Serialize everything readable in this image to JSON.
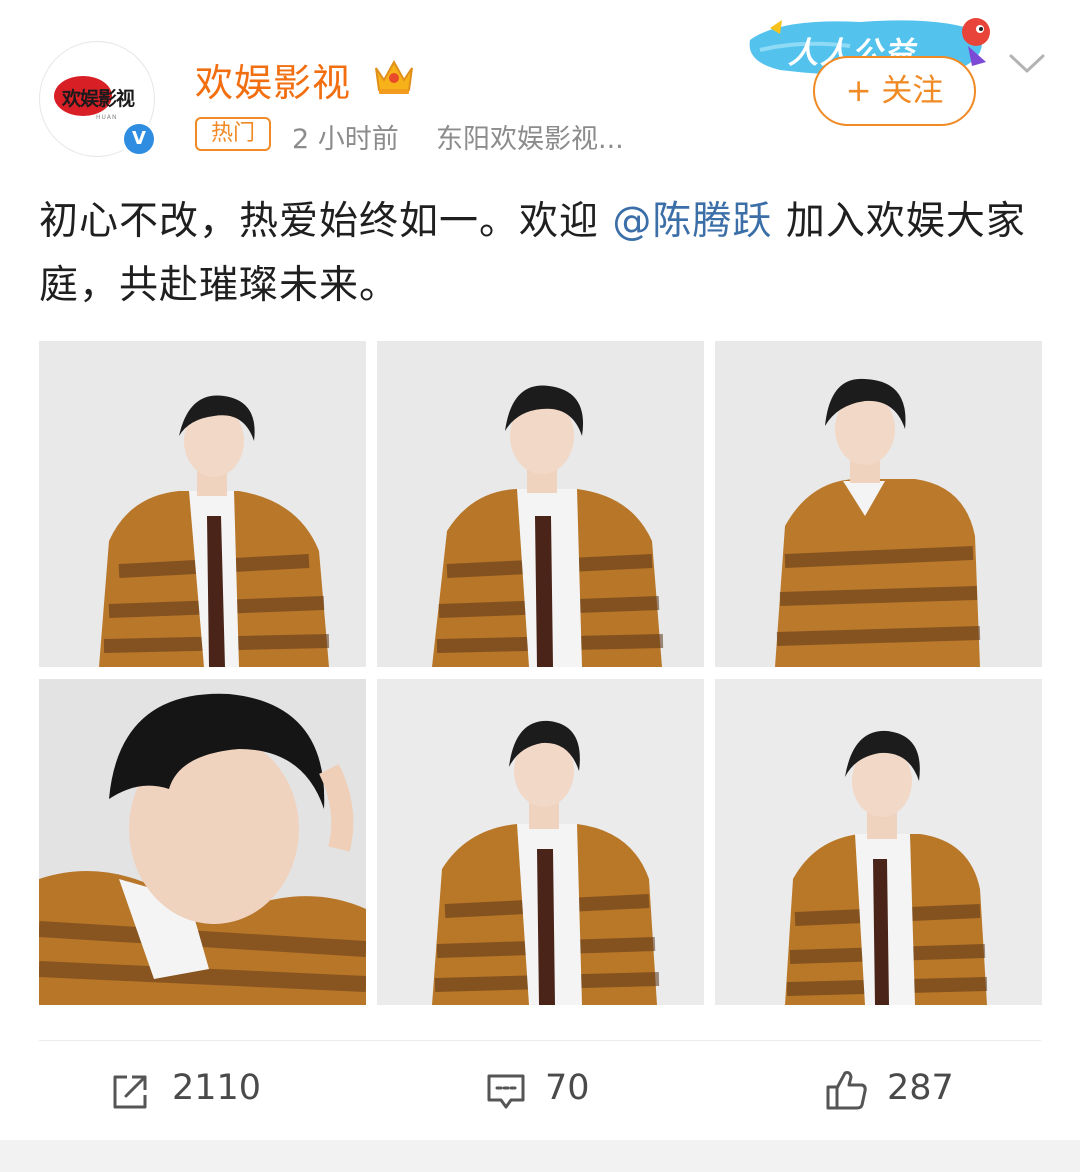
{
  "account": {
    "name": "欢娱影视",
    "avatar_logo_text": "欢娱影视",
    "avatar_logo_sub": "HUAN",
    "verified_mark": "V",
    "crown_icon": "crown-icon"
  },
  "meta": {
    "hot_tag": "热门",
    "time": "2 小时前",
    "source": "东阳欢娱影视..."
  },
  "promo": {
    "text": "人人公益"
  },
  "follow_button": {
    "label": "+ 关注"
  },
  "post": {
    "text_before": "初心不改，热爱始终如一。欢迎 ",
    "mention": "@陈腾跃",
    "text_after": " 加入欢娱大家庭，共赴璀璨未来。"
  },
  "actions": {
    "repost": {
      "icon": "share-icon",
      "count": "2110"
    },
    "comment": {
      "icon": "comment-icon",
      "count": "70"
    },
    "like": {
      "icon": "thumbs-up-icon",
      "count": "287"
    }
  },
  "colors": {
    "accent_orange": "#f26f11",
    "follow_orange": "#f08a24",
    "mention_blue": "#3c6fa8",
    "verified_blue": "#2e8de0",
    "text_gray": "#8c8c8c"
  }
}
